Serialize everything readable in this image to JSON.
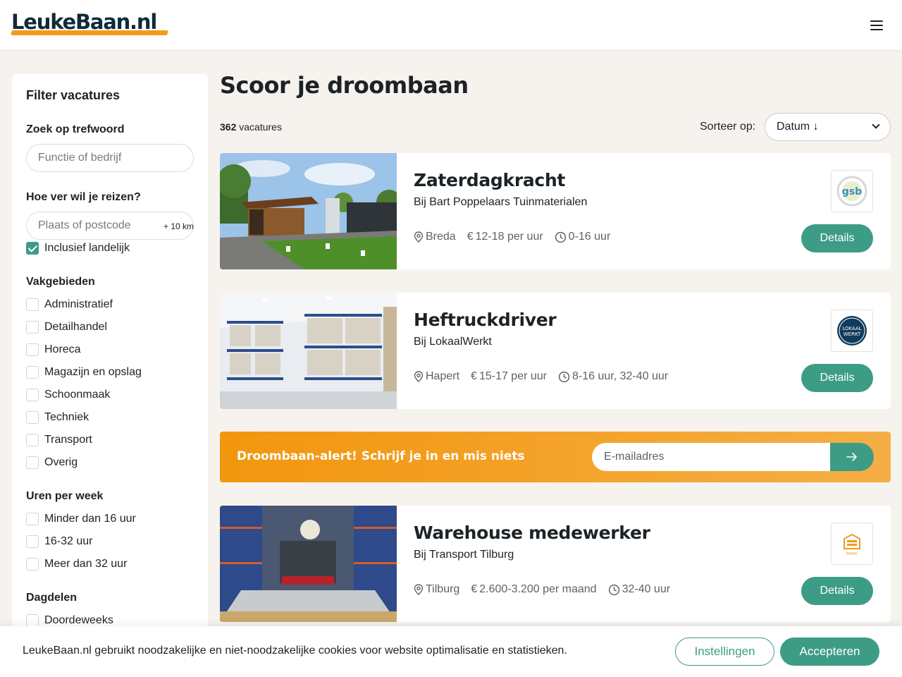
{
  "header": {
    "logo": "LeukeBaan.nl",
    "menu_icon": "hamburger-icon"
  },
  "sidebar": {
    "title": "Filter vacatures",
    "keyword": {
      "label": "Zoek op trefwoord",
      "placeholder": "Functie of bedrijf"
    },
    "distance": {
      "label": "Hoe ver wil je reizen?",
      "placeholder": "Plaats of postcode",
      "radius": "+ 10 km"
    },
    "national": {
      "label": "Inclusief landelijk",
      "checked": true
    },
    "fields": {
      "label": "Vakgebieden",
      "items": [
        "Administratief",
        "Detailhandel",
        "Horeca",
        "Magazijn en opslag",
        "Schoonmaak",
        "Techniek",
        "Transport",
        "Overig"
      ]
    },
    "hours": {
      "label": "Uren per week",
      "items": [
        "Minder dan 16 uur",
        "16-32 uur",
        "Meer dan 32 uur"
      ]
    },
    "dayparts": {
      "label": "Dagdelen",
      "items": [
        "Doordeweeks"
      ]
    }
  },
  "main": {
    "title": "Scoor je droombaan",
    "count_number": "362",
    "count_label": "vacatures",
    "sort_label": "Sorteer op:",
    "sort_value": "Datum ↓"
  },
  "jobs": [
    {
      "title": "Zaterdagkracht",
      "company": "Bij Bart Poppelaars Tuinmaterialen",
      "location": "Breda",
      "salary": "12-18 per uur",
      "hours": "0-16 uur",
      "details": "Details"
    },
    {
      "title": "Heftruckdriver",
      "company": "Bij LokaalWerkt",
      "location": "Hapert",
      "salary": "15-17 per uur",
      "hours": "8-16 uur, 32-40 uur",
      "details": "Details"
    },
    {
      "title": "Warehouse medewerker",
      "company": "Bij Transport Tilburg",
      "location": "Tilburg",
      "salary": "2.600-3.200 per maand",
      "hours": "32-40 uur",
      "details": "Details"
    }
  ],
  "logos": {
    "gsb": "gsb",
    "lokaal_line1": "LOKAAL",
    "lokaal_line2": "WERKT",
    "repav": "REPAV"
  },
  "alert": {
    "text": "Droombaan-alert! Schrijf je in en mis niets",
    "placeholder": "E-mailadres"
  },
  "cookie": {
    "text": "LeukeBaan.nl gebruikt noodzakelijke en niet-noodzakelijke cookies voor website optimalisatie en statistieken.",
    "settings": "Instellingen",
    "accept": "Accepteren"
  },
  "colors": {
    "accent": "#3d9c85",
    "orange": "#f39a1e",
    "navy": "#0f2b3a",
    "background": "#f6f3ee"
  }
}
